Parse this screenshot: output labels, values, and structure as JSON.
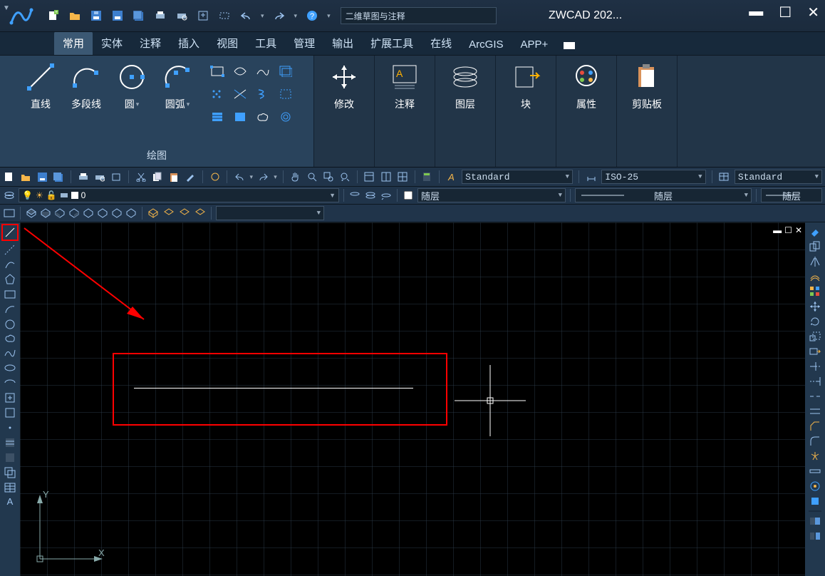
{
  "title_app": "ZWCAD 202...",
  "workspace": "二维草图与注释",
  "tabs": {
    "home": "常用",
    "solid": "实体",
    "annot": "注释",
    "insert": "插入",
    "view": "视图",
    "tool": "工具",
    "manage": "管理",
    "output": "输出",
    "ext": "扩展工具",
    "online": "在线",
    "arcgis": "ArcGIS",
    "appplus": "APP+"
  },
  "panels": {
    "draw": "绘图",
    "modify": "修改",
    "annot": "注释",
    "layer": "图层",
    "block": "块",
    "prop": "属性",
    "clip": "剪贴板"
  },
  "buttons": {
    "line": "直线",
    "pline": "多段线",
    "circle": "圆",
    "arc": "圆弧"
  },
  "styles": {
    "text": "Standard",
    "dim": "ISO-25",
    "table": "Standard"
  },
  "linetype": {
    "bylayer": "随层",
    "bylayer2": "随层",
    "bylayer3": "随层"
  },
  "layer": {
    "zero": "0"
  },
  "ucs": {
    "y": "Y",
    "x": "X"
  }
}
